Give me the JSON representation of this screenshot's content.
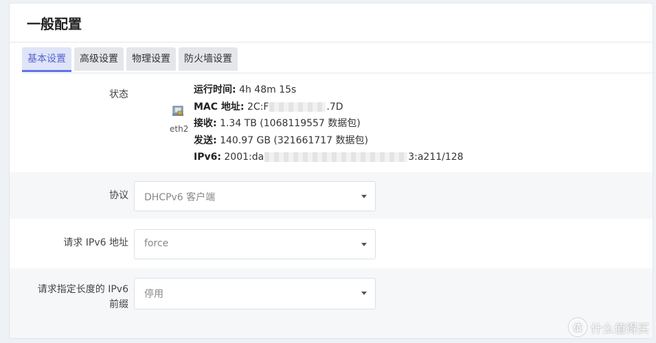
{
  "page": {
    "title": "一般配置"
  },
  "tabs": [
    {
      "label": "基本设置",
      "active": true
    },
    {
      "label": "高级设置",
      "active": false
    },
    {
      "label": "物理设置",
      "active": false
    },
    {
      "label": "防火墙设置",
      "active": false
    }
  ],
  "status": {
    "label": "状态",
    "interface": "eth2",
    "uptime_label": "运行时间:",
    "uptime_value": "4h 48m 15s",
    "mac_label": "MAC 地址:",
    "mac_prefix": "2C:F",
    "mac_suffix": ".7D",
    "rx_label": "接收:",
    "rx_value": "1.34 TB (1068119557 数据包)",
    "tx_label": "发送:",
    "tx_value": "140.97 GB (321661717 数据包)",
    "ipv6_label": "IPv6:",
    "ipv6_prefix": "2001:da",
    "ipv6_suffix": "3:a211/128"
  },
  "protocol": {
    "label": "协议",
    "value": "DHCPv6 客户端"
  },
  "request_ipv6": {
    "label": "请求 IPv6 地址",
    "value": "force"
  },
  "prefix_length": {
    "label_line1": "请求指定长度的 IPv6",
    "label_line2": "前缀",
    "value": "停用"
  },
  "watermark": {
    "text": "什么值得买",
    "icon_glyph": "值"
  },
  "colors": {
    "accent": "#5e72e4",
    "active_tab_bg": "#dfe4f8"
  }
}
